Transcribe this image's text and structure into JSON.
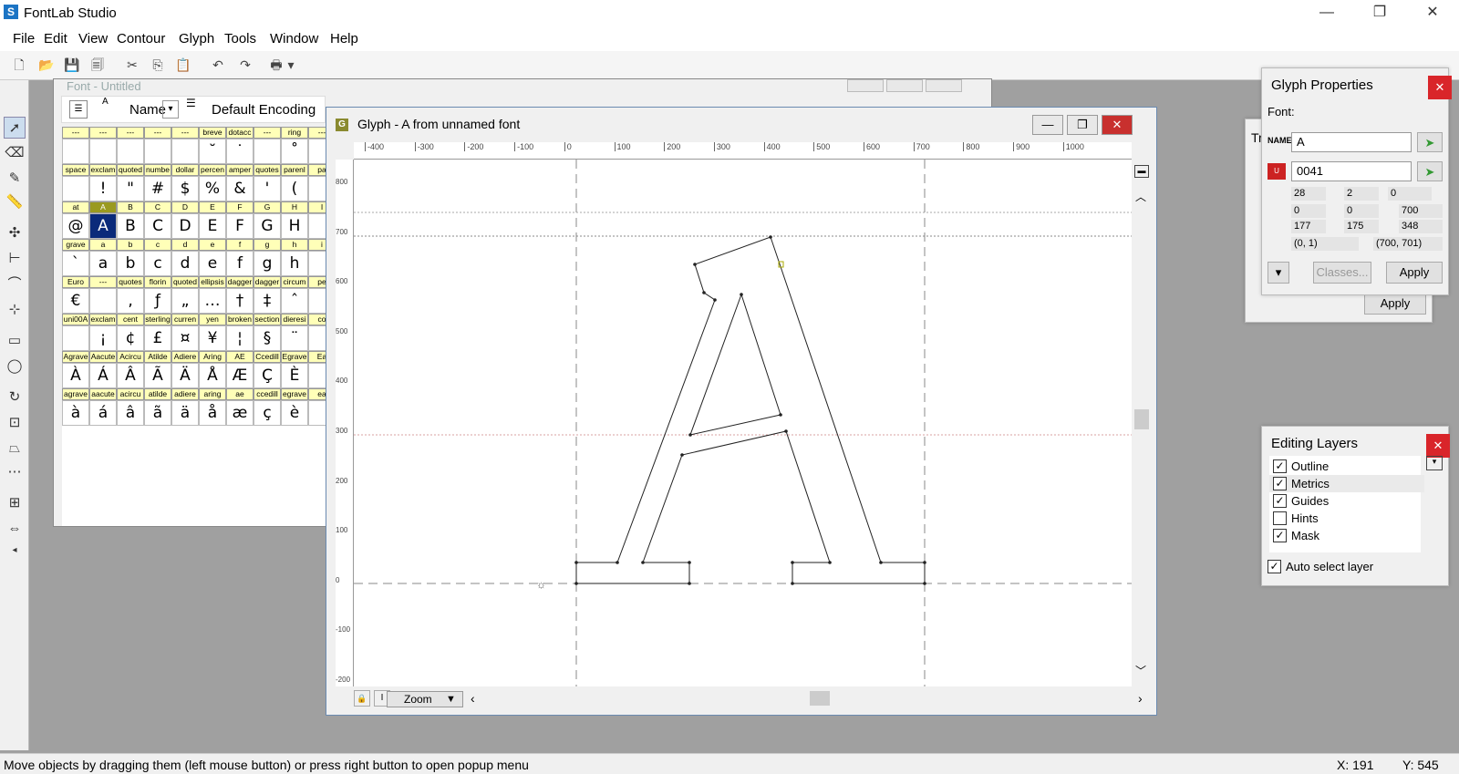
{
  "app": {
    "title": "FontLab Studio"
  },
  "menu": [
    "File",
    "Edit",
    "View",
    "Contour",
    "Glyph",
    "Tools",
    "Window",
    "Help"
  ],
  "font_window": {
    "title": "Font - Untitled",
    "name_mode": "Name",
    "encoding": "Default Encoding",
    "grid": [
      {
        "labels": [
          "---",
          "---",
          "---",
          "---",
          "---",
          "breve",
          "dotacc",
          "---",
          "ring",
          "---"
        ],
        "glyphs": [
          "",
          "",
          "",
          "",
          "",
          "˘",
          "˙",
          "",
          "˚",
          ""
        ]
      },
      {
        "labels": [
          "space",
          "exclam",
          "quoted",
          "numbe",
          "dollar",
          "percen",
          "amper",
          "quotes",
          "parenl",
          "pa"
        ],
        "glyphs": [
          "",
          "!",
          "\"",
          "#",
          "$",
          "%",
          "&",
          "'",
          "(",
          ""
        ]
      },
      {
        "labels": [
          "at",
          "A",
          "B",
          "C",
          "D",
          "E",
          "F",
          "G",
          "H",
          "I"
        ],
        "glyphs": [
          "@",
          "A",
          "B",
          "C",
          "D",
          "E",
          "F",
          "G",
          "H",
          ""
        ]
      },
      {
        "labels": [
          "grave",
          "a",
          "b",
          "c",
          "d",
          "e",
          "f",
          "g",
          "h",
          "i"
        ],
        "glyphs": [
          "`",
          "a",
          "b",
          "c",
          "d",
          "e",
          "f",
          "g",
          "h",
          ""
        ]
      },
      {
        "labels": [
          "Euro",
          "---",
          "quotes",
          "florin",
          "quoted",
          "ellipsis",
          "dagger",
          "dagger",
          "circum",
          "pe"
        ],
        "glyphs": [
          "€",
          "",
          "‚",
          "ƒ",
          "„",
          "…",
          "†",
          "‡",
          "ˆ",
          ""
        ]
      },
      {
        "labels": [
          "uni00A",
          "exclam",
          "cent",
          "sterling",
          "curren",
          "yen",
          "broken",
          "section",
          "dieresi",
          "co"
        ],
        "glyphs": [
          "",
          "¡",
          "¢",
          "£",
          "¤",
          "¥",
          "¦",
          "§",
          "¨",
          ""
        ]
      },
      {
        "labels": [
          "Agrave",
          "Aacute",
          "Acircu",
          "Atilde",
          "Adiere",
          "Aring",
          "AE",
          "Ccedill",
          "Egrave",
          "Ea"
        ],
        "glyphs": [
          "À",
          "Á",
          "Â",
          "Ã",
          "Ä",
          "Å",
          "Æ",
          "Ç",
          "È",
          ""
        ]
      },
      {
        "labels": [
          "agrave",
          "aacute",
          "acircu",
          "atilde",
          "adiere",
          "aring",
          "ae",
          "ccedill",
          "egrave",
          "ea"
        ],
        "glyphs": [
          "à",
          "á",
          "â",
          "ã",
          "ä",
          "å",
          "æ",
          "ç",
          "è",
          ""
        ]
      }
    ]
  },
  "glyph_window": {
    "title": "Glyph - A from unnamed font",
    "hruler": [
      "-400",
      "-300",
      "-200",
      "-100",
      "0",
      "100",
      "200",
      "300",
      "400",
      "500",
      "600",
      "700",
      "800",
      "900",
      "1000"
    ],
    "vruler": [
      "800",
      "700",
      "600",
      "500",
      "400",
      "300",
      "200",
      "100",
      "0",
      "-100",
      "-200"
    ],
    "zoom_label": "Zoom"
  },
  "glyph_properties": {
    "title": "Glyph Properties",
    "font_label": "Font:",
    "name_value": "A",
    "unicode_value": "0041",
    "stats": [
      "28",
      "2",
      "0",
      "0",
      "0",
      "700",
      "177",
      "175",
      "348",
      "(0, 1)",
      "(700, 701)"
    ],
    "classes_label": "Classes...",
    "apply_label": "Apply"
  },
  "behind_panel": {
    "title_fragment": "Tr",
    "apply_label": "Apply"
  },
  "editing_layers": {
    "title": "Editing Layers",
    "layers": [
      {
        "name": "Outline",
        "checked": "✓"
      },
      {
        "name": "Metrics",
        "checked": "✓"
      },
      {
        "name": "Guides",
        "checked": "✓"
      },
      {
        "name": "Hints",
        "checked": ""
      },
      {
        "name": "Mask",
        "checked": "✓"
      }
    ],
    "auto_select": {
      "name": "Auto select layer",
      "checked": "✓"
    }
  },
  "status": {
    "message": "Move objects by dragging them (left mouse button) or press right button to open popup menu",
    "x": "X: 191",
    "y": "Y: 545"
  }
}
